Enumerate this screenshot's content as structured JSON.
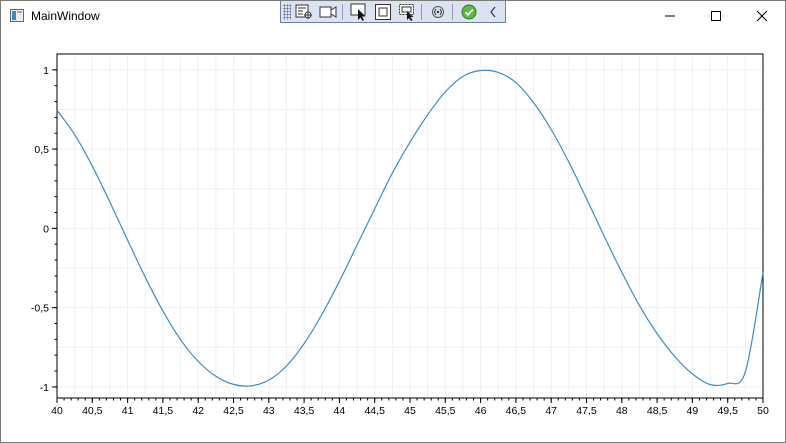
{
  "window": {
    "title": "MainWindow",
    "controls": {
      "minimize": "minimize",
      "maximize": "maximize",
      "close": "close"
    }
  },
  "devtools_toolbar": {
    "tools": [
      {
        "icon": "live-visual-tree-icon"
      },
      {
        "icon": "record-icon"
      },
      {
        "icon": "select-element-icon"
      },
      {
        "icon": "display-layout-adorners-icon"
      },
      {
        "icon": "track-focus-icon"
      },
      {
        "icon": "binding-failures-icon"
      },
      {
        "icon": "hot-reload-ok-icon"
      },
      {
        "icon": "collapse-toolbar-icon"
      }
    ]
  },
  "chart_data": {
    "type": "line",
    "title": "",
    "xlabel": "",
    "ylabel": "",
    "xlim": [
      40,
      50
    ],
    "ylim": [
      -1.07,
      1.1
    ],
    "x_ticks": [
      40,
      40.5,
      41,
      41.5,
      42,
      42.5,
      43,
      43.5,
      44,
      44.5,
      45,
      45.5,
      46,
      46.5,
      47,
      47.5,
      48,
      48.5,
      49,
      49.5,
      50
    ],
    "x_tick_labels": [
      "40",
      "40,5",
      "41",
      "41,5",
      "42",
      "42,5",
      "43",
      "43,5",
      "44",
      "44,5",
      "45",
      "45,5",
      "46",
      "46,5",
      "47",
      "47,5",
      "48",
      "48,5",
      "49",
      "49,5",
      "50"
    ],
    "y_ticks": [
      -1,
      -0.5,
      0,
      0.5,
      1
    ],
    "y_tick_labels": [
      "-1",
      "-0,5",
      "0",
      "0,5",
      "1"
    ],
    "grid": true,
    "line_color": "#3a8fc4",
    "series": [
      {
        "x": [
          40,
          40.25,
          40.5,
          40.75,
          41,
          41.25,
          41.5,
          41.75,
          42,
          42.25,
          42.5,
          42.75,
          43,
          43.25,
          43.5,
          43.75,
          44,
          44.25,
          44.5,
          44.75,
          45,
          45.25,
          45.5,
          45.75,
          46,
          46.25,
          46.5,
          46.75,
          47,
          47.25,
          47.5,
          47.75,
          48,
          48.25,
          48.5,
          48.75,
          49,
          49.25,
          49.5,
          49.75,
          50
        ],
        "y": [
          0.745,
          0.592,
          0.393,
          0.165,
          -0.074,
          -0.308,
          -0.521,
          -0.702,
          -0.839,
          -0.933,
          -0.984,
          -0.993,
          -0.957,
          -0.868,
          -0.727,
          -0.544,
          -0.334,
          -0.105,
          0.123,
          0.349,
          0.544,
          0.716,
          0.861,
          0.959,
          0.996,
          0.984,
          0.92,
          0.793,
          0.623,
          0.418,
          0.188,
          -0.049,
          -0.277,
          -0.487,
          -0.664,
          -0.808,
          -0.918,
          -0.985,
          -0.978,
          -0.905,
          -0.279
        ]
      }
    ]
  }
}
